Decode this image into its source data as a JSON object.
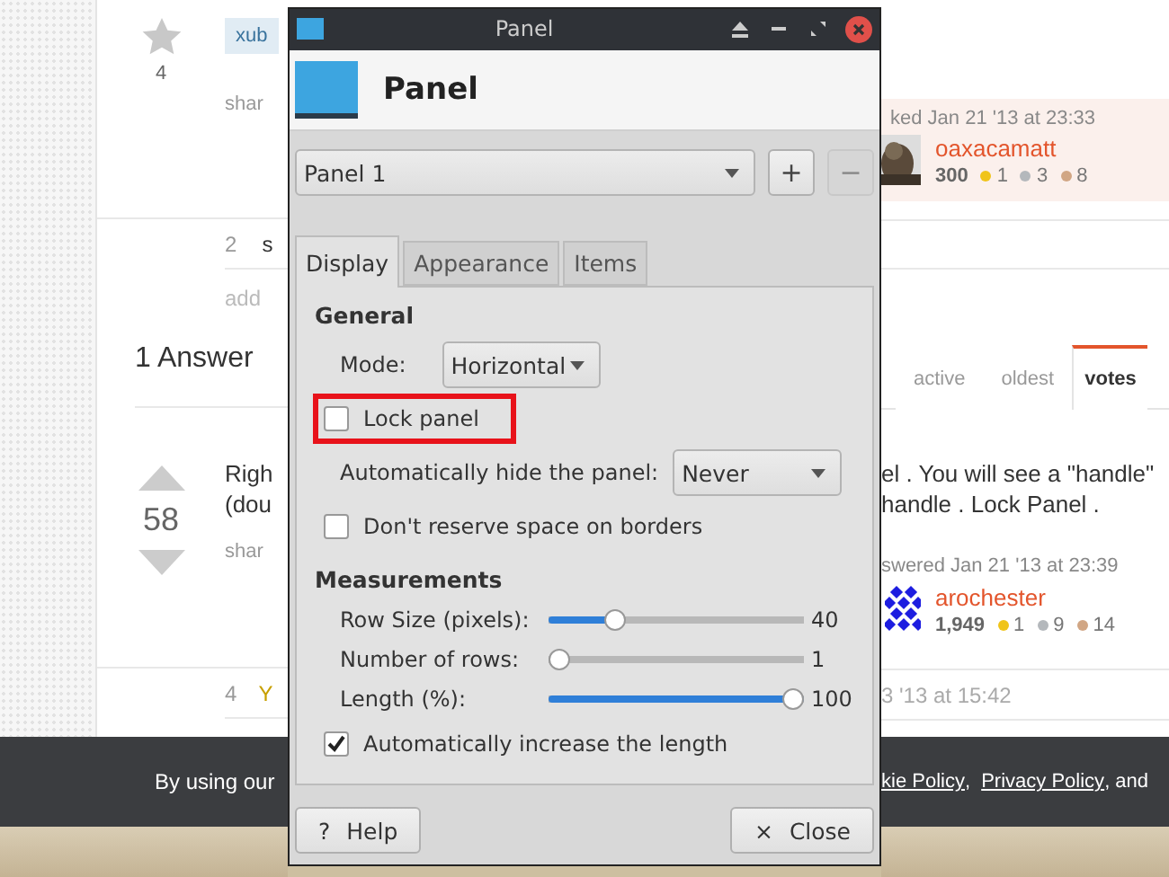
{
  "page_left": {
    "favorite_count": "4",
    "tag": "xub",
    "question_share": "shar",
    "comment_score": "2",
    "comment_text": "s",
    "add_comment": "add",
    "answers_heading": "1 Answer",
    "answer_lines": [
      "Righ",
      "(dou"
    ],
    "answer_score": "58",
    "answer_share": "shar",
    "comment2_score": "4",
    "comment2_text": "Y",
    "footer_text": "By using our"
  },
  "dialog": {
    "title": "Panel",
    "heading": "Panel",
    "panel_select": "Panel 1",
    "add_button": "+",
    "remove_button": {
      "label": "−",
      "disabled": true
    },
    "tabs": [
      {
        "label": "Display",
        "selected": true
      },
      {
        "label": "Appearance",
        "selected": false
      },
      {
        "label": "Items",
        "selected": false
      }
    ],
    "sections": [
      {
        "heading": "General",
        "rows": [
          {
            "kind": "combo",
            "label": "Mode:",
            "value": "Horizontal",
            "highlighted": false
          },
          {
            "kind": "checkbox",
            "label": "Lock panel",
            "checked": false,
            "highlighted": true
          },
          {
            "kind": "combo",
            "label": "Automatically hide the panel:",
            "value": "Never",
            "highlighted": false
          },
          {
            "kind": "checkbox",
            "label": "Don't reserve space on borders",
            "checked": false,
            "highlighted": false
          }
        ]
      },
      {
        "heading": "Measurements",
        "rows": [
          {
            "kind": "slider",
            "label": "Row Size (pixels):",
            "level": 0.24,
            "reading": "40",
            "highlighted": false
          },
          {
            "kind": "slider",
            "label": "Number of rows:",
            "level": 0,
            "reading": "1",
            "highlighted": false
          },
          {
            "kind": "slider",
            "label": "Length (%):",
            "level": 1,
            "reading": "100",
            "highlighted": false
          },
          {
            "kind": "checkbox",
            "label": "Automatically increase the length",
            "checked": true,
            "highlighted": false
          }
        ]
      }
    ],
    "buttons": [
      {
        "icon": "?",
        "label": "Help"
      },
      {
        "icon": "×",
        "label": "Close"
      }
    ]
  },
  "page_right": {
    "asked": "ked Jan 21 '13 at 23:33",
    "asker": {
      "name": "oaxacamatt",
      "rep": "300",
      "badges": [
        {
          "count": "1",
          "color": "#f0c419"
        },
        {
          "count": "3",
          "color": "#b4b8bc"
        },
        {
          "count": "8",
          "color": "#d1a684"
        }
      ]
    },
    "sort_tabs": [
      {
        "label": "active",
        "selected": false
      },
      {
        "label": "oldest",
        "selected": false
      },
      {
        "label": "votes",
        "selected": true
      }
    ],
    "answer_lines": [
      "el . You will see a \"handle\"",
      "handle . Lock Panel ."
    ],
    "answered": "swered Jan 21 '13 at 23:39",
    "answerer": {
      "name": "arochester",
      "rep": "1,949",
      "badges": [
        {
          "count": "1",
          "color": "#f0c419"
        },
        {
          "count": "9",
          "color": "#b4b8bc"
        },
        {
          "count": "14",
          "color": "#d1a684"
        }
      ]
    },
    "comment_time": "3 '13 at 15:42",
    "footer_parts": [
      {
        "kind": "link",
        "text": "kie Policy"
      },
      {
        "kind": "text",
        "text": ", "
      },
      {
        "kind": "link",
        "text": "Privacy Policy"
      },
      {
        "kind": "text",
        "text": ", and"
      }
    ]
  }
}
